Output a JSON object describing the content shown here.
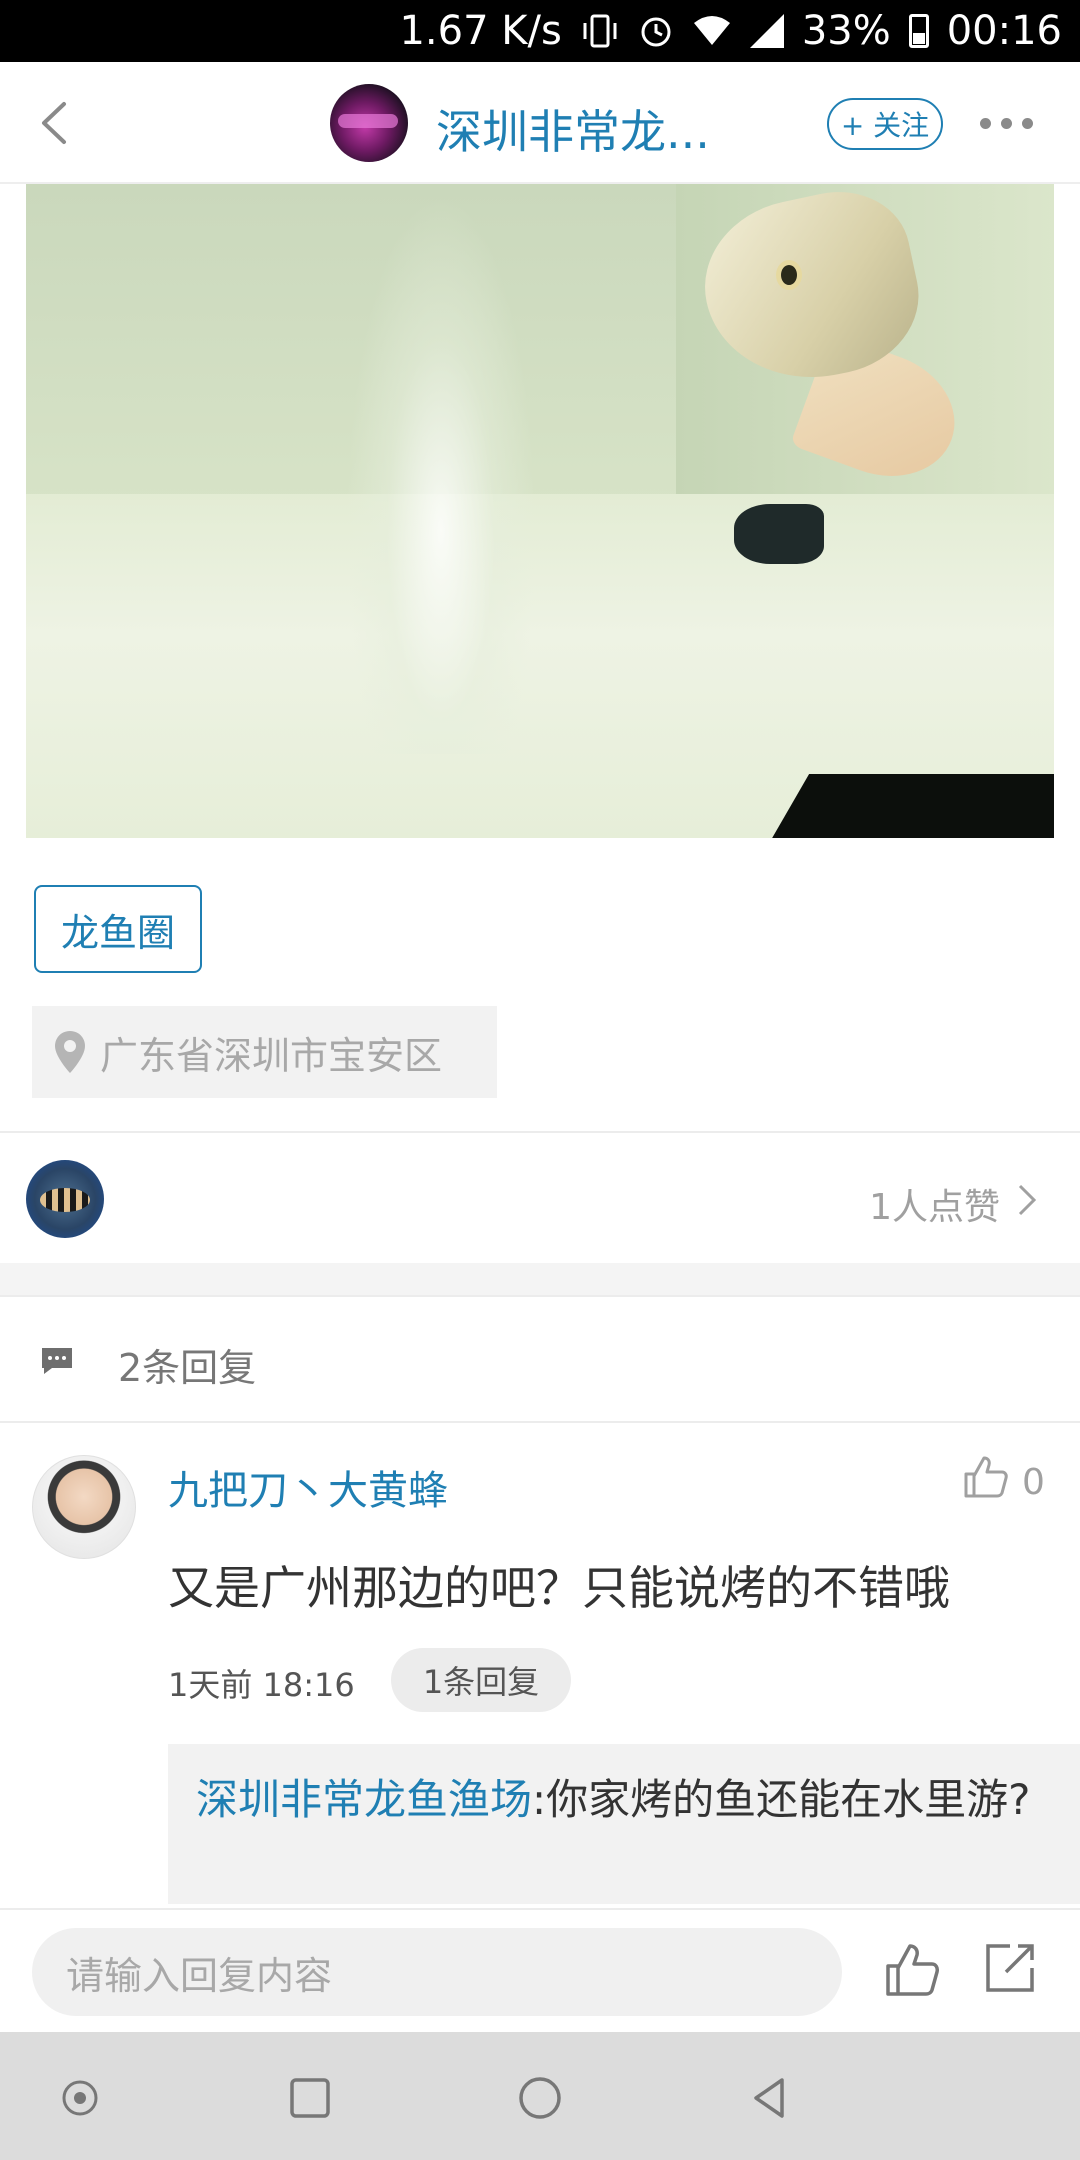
{
  "status_bar": {
    "speed": "1.67 K/s",
    "battery_percent": "33%",
    "time": "00:16"
  },
  "header": {
    "title": "深圳非常龙...",
    "follow_label": "+ 关注"
  },
  "post": {
    "tag": "龙鱼圈",
    "location": "广东省深圳市宝安区"
  },
  "likes": {
    "summary": "1人点赞"
  },
  "replies": {
    "count_label": "2条回复",
    "items": [
      {
        "author": "九把刀丶大黄蜂",
        "like_count": "0",
        "text": "又是广州那边的吧？只能说烤的不错哦",
        "time": "1天前 18:16",
        "replies_label": "1条回复",
        "sub_reply": {
          "author": "深圳非常龙鱼渔场",
          "text": ":你家烤的鱼还能在水里游?"
        }
      }
    ]
  },
  "input_bar": {
    "placeholder": "请输入回复内容"
  },
  "colors": {
    "accent": "#1f7fb3",
    "muted_text": "#a0a0a0",
    "panel_bg": "#f2f2f2"
  }
}
